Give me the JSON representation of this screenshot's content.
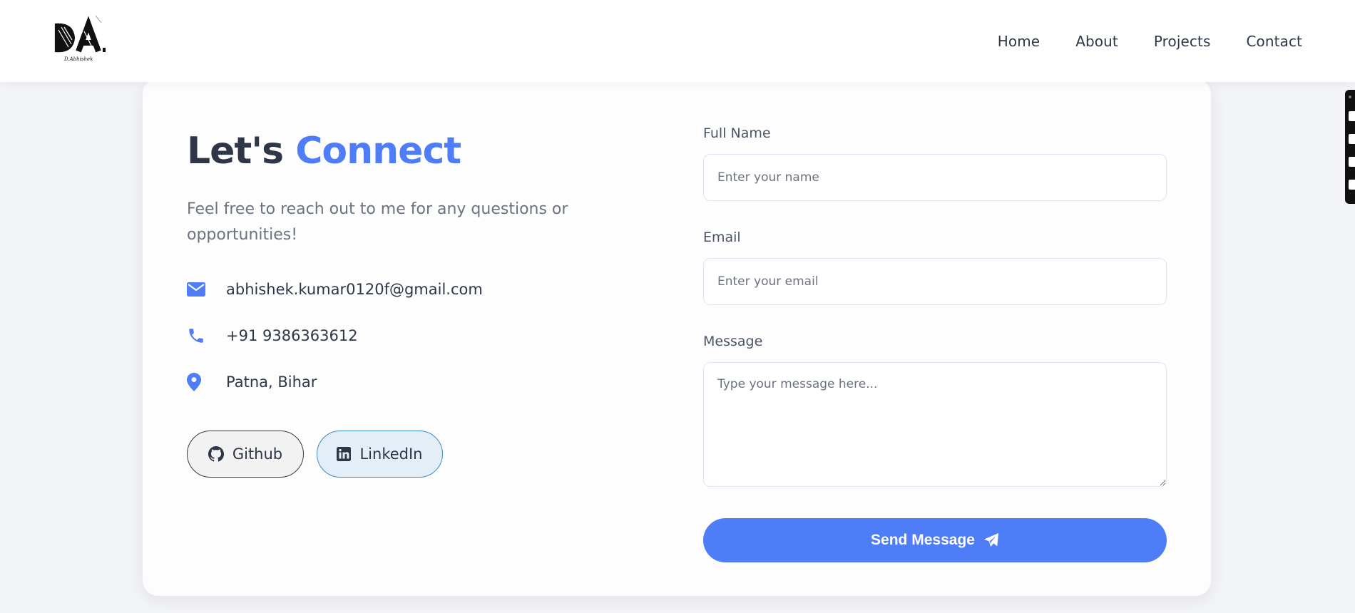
{
  "brand": {
    "logo_text": "DA",
    "logo_subtext": "D.Abhishek"
  },
  "nav": {
    "items": [
      {
        "label": "Home"
      },
      {
        "label": "About"
      },
      {
        "label": "Projects"
      },
      {
        "label": "Contact"
      }
    ]
  },
  "contact": {
    "title_main": "Let's",
    "title_accent": "Connect",
    "description": "Feel free to reach out to me for any questions or opportunities!",
    "items": [
      {
        "icon": "envelope-icon",
        "text": "abhishek.kumar0120f@gmail.com"
      },
      {
        "icon": "phone-icon",
        "text": "+91 9386363612"
      },
      {
        "icon": "map-pin-icon",
        "text": "Patna, Bihar"
      }
    ],
    "social": [
      {
        "icon": "github-icon",
        "label": "Github"
      },
      {
        "icon": "linkedin-icon",
        "label": "LinkedIn"
      }
    ]
  },
  "form": {
    "name_label": "Full Name",
    "name_placeholder": "Enter your name",
    "email_label": "Email",
    "email_placeholder": "Enter your email",
    "message_label": "Message",
    "message_placeholder": "Type your message here...",
    "submit_label": "Send Message"
  },
  "colors": {
    "accent": "#4f7cf7",
    "text": "#2d3748",
    "muted": "#6b7280",
    "page_bg": "#f3f4f7"
  }
}
